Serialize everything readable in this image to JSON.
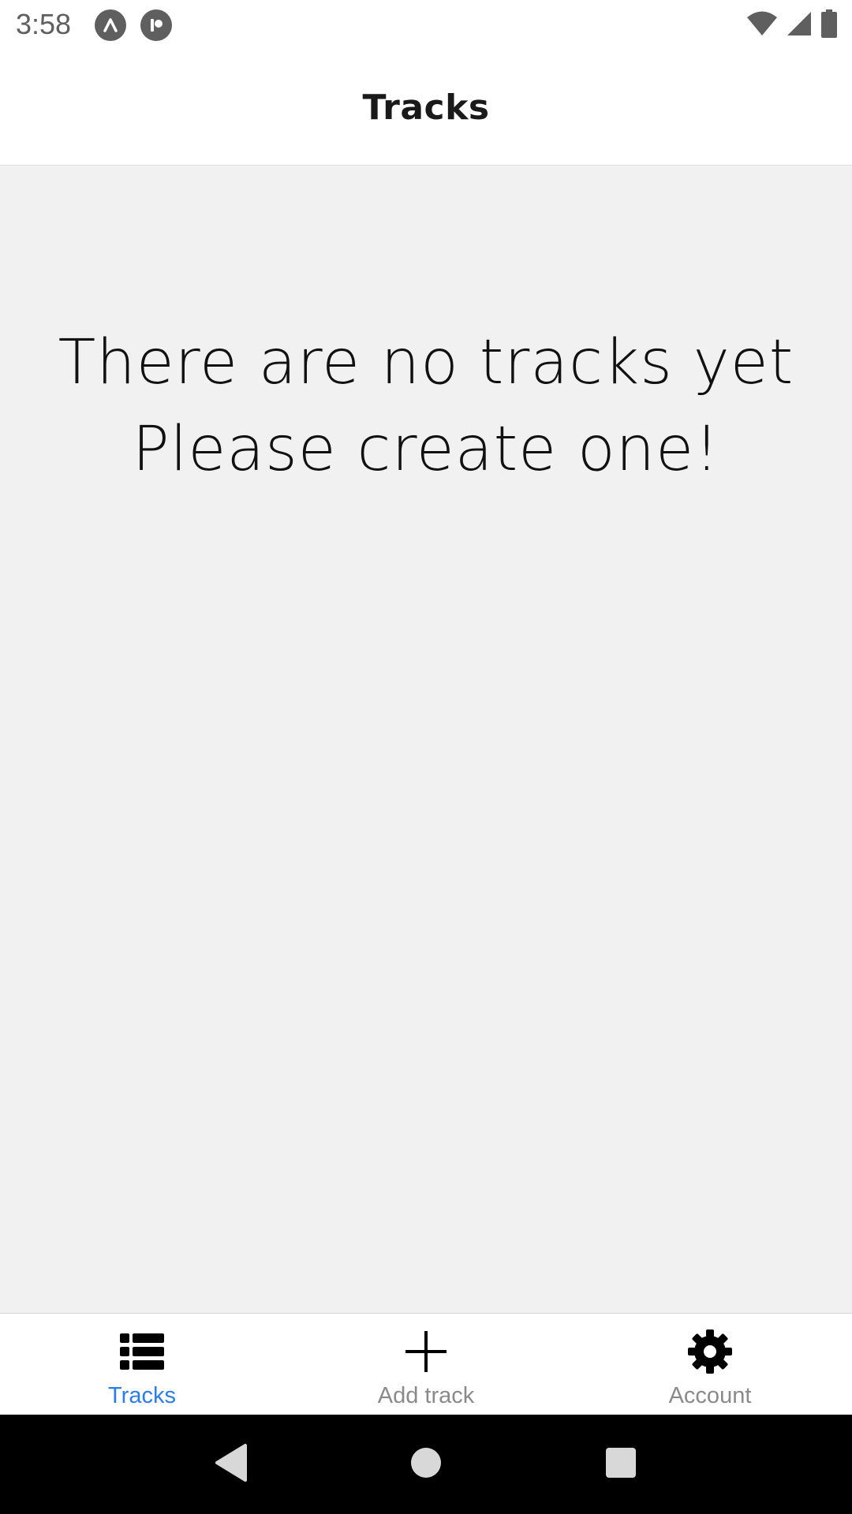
{
  "status_bar": {
    "time": "3:58",
    "app_icons": [
      "notification-app-a-icon",
      "notification-app-b-icon"
    ],
    "right_icons": [
      "wifi-icon",
      "cell-signal-icon",
      "battery-icon"
    ]
  },
  "header": {
    "title": "Tracks"
  },
  "empty_state": {
    "line1": "There are no tracks yet",
    "line2": "Please create one!"
  },
  "bottom_nav": {
    "items": [
      {
        "label": "Tracks",
        "icon": "list-icon",
        "active": true
      },
      {
        "label": "Add track",
        "icon": "plus-icon",
        "active": false
      },
      {
        "label": "Account",
        "icon": "gear-icon",
        "active": false
      }
    ]
  },
  "colors": {
    "accent": "#2b7de9",
    "inactive": "#8a8a8a",
    "background": "#f1f1f1",
    "header": "#ffffff"
  }
}
